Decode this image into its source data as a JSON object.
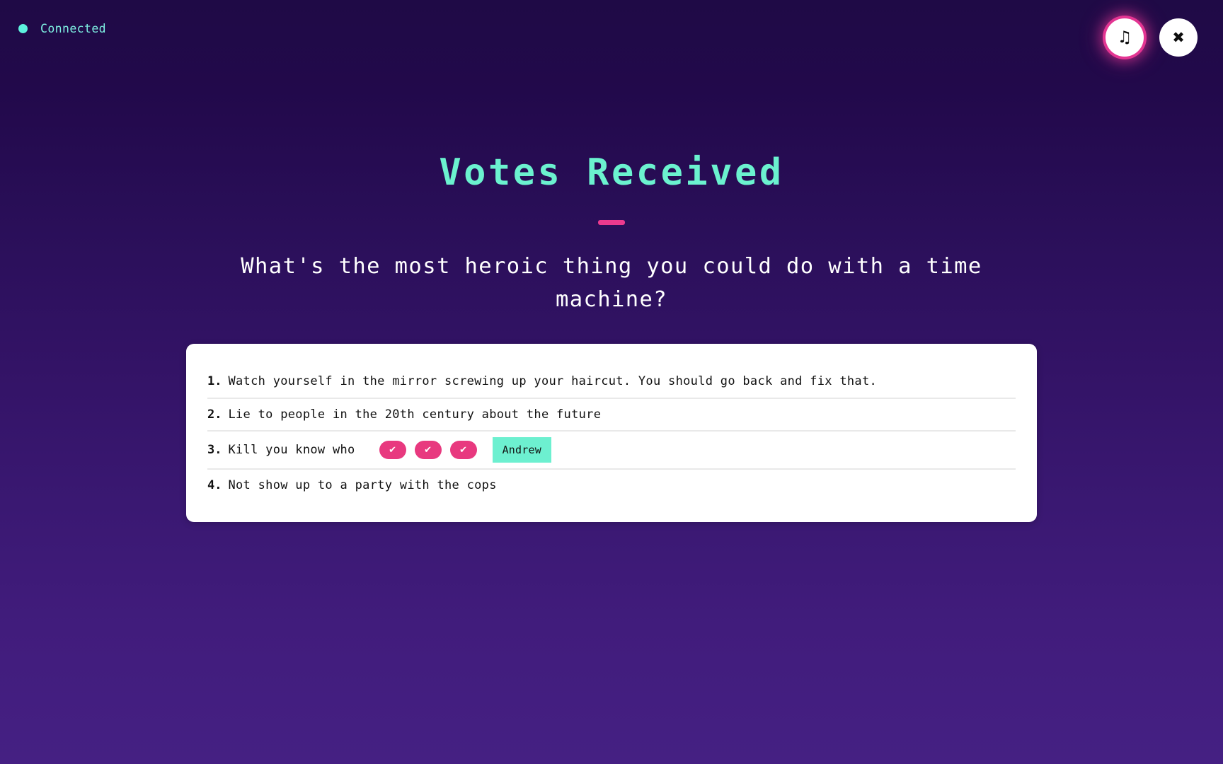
{
  "status": {
    "label": "Connected",
    "dot_color": "#5df2de",
    "text_color": "#7ef0e2"
  },
  "top_buttons": [
    {
      "name": "music-toggle",
      "icon": "music-note-icon",
      "glyph": "♫",
      "active": true
    },
    {
      "name": "close",
      "icon": "close-icon",
      "glyph": "✖",
      "active": false
    }
  ],
  "header": {
    "title": "Votes Received",
    "title_color": "#6bf2cf",
    "accent_color": "#ec3a8e",
    "question": "What's the most heroic thing you could do with a time machine?"
  },
  "answers": [
    {
      "number": "1.",
      "text": "Watch yourself in the mirror screwing up your haircut. You should go back and fix that.",
      "votes": 0,
      "voters": []
    },
    {
      "number": "2.",
      "text": "Lie to people in the 20th century about the future",
      "votes": 0,
      "voters": []
    },
    {
      "number": "3.",
      "text": "Kill you know who",
      "votes": 3,
      "vote_glyph": "✔",
      "voters": [
        "Andrew"
      ]
    },
    {
      "number": "4.",
      "text": "Not show up to a party with the cops",
      "votes": 0,
      "voters": []
    }
  ],
  "theme": {
    "bg_top": "#1f0a46",
    "bg_bottom": "#452083",
    "card_bg": "#ffffff",
    "pink": "#e8397f",
    "mint": "#6df0d0",
    "divider": "#e9e9e9"
  }
}
